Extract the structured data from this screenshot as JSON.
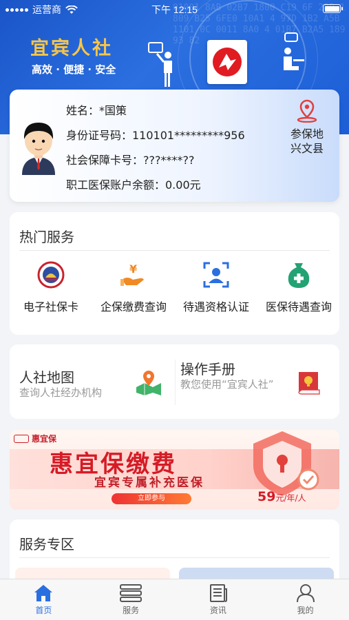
{
  "status_bar": {
    "carrier": "运营商",
    "time": "下午 12:15"
  },
  "header": {
    "app_title": "宜宾人社",
    "slogan": "高效 · 便捷 · 安全",
    "background_digits": "01001 8AB 02B7 1800 C19 6F 28B 1809 B25 6FE0 10A1 4 97D 1B2 A5B 1101 0C 0011 8A0 4 01B7 B2A5 18993 82"
  },
  "profile": {
    "name_line": "姓名：*国策",
    "id_line": "身份证号码：110101*********956",
    "social_card_line": "社会保障卡号：???****??",
    "balance_line": "职工医保账户余额：0.00元",
    "insured_place_label": "参保地",
    "insured_place_value": "兴文县"
  },
  "hot_services": {
    "title": "热门服务",
    "items": [
      {
        "label": "电子社保卡",
        "icon": "social-security-card-icon"
      },
      {
        "label": "企保缴费查询",
        "icon": "yen-hand-icon"
      },
      {
        "label": "待遇资格认证",
        "icon": "face-scan-icon"
      },
      {
        "label": "医保待遇查询",
        "icon": "medical-bag-icon"
      }
    ]
  },
  "quick_cards": {
    "map": {
      "title": "人社地图",
      "subtitle": "查询人社经办机构"
    },
    "manual": {
      "title": "操作手册",
      "subtitle": "教您使用“宜宾人社”"
    }
  },
  "banner": {
    "brand": "惠宜保",
    "headline": "惠宜保缴费",
    "subline": "宜宾专属补充医保",
    "join_label": "立即参与",
    "price": "59",
    "price_unit": "元/年/人"
  },
  "service_zone": {
    "title": "服务专区"
  },
  "tab_bar": {
    "items": [
      {
        "label": "首页",
        "active": true
      },
      {
        "label": "服务",
        "active": false
      },
      {
        "label": "资讯",
        "active": false
      },
      {
        "label": "我的",
        "active": false
      }
    ]
  },
  "colors": {
    "primary_blue": "#2a6fe0",
    "title_gold": "#f7c548",
    "banner_red": "#d51b26"
  }
}
